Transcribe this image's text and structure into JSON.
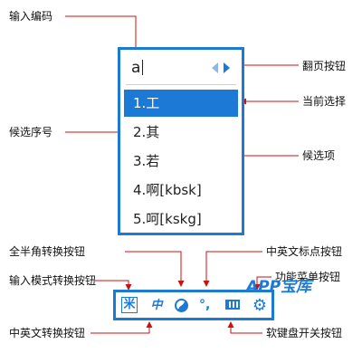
{
  "labels": {
    "input_code": "输入编码",
    "page_button": "翻页按钮",
    "current_choice": "当前选择",
    "candidate_number": "候选序号",
    "candidate_item": "候选项",
    "full_half_toggle": "全半角转换按钮",
    "cn_en_punct": "中英文标点按钮",
    "input_mode_toggle": "输入模式转换按钮",
    "menu_button": "功能菜单按钮",
    "cn_en_toggle": "中英文转换按钮",
    "soft_keyboard_toggle": "软键盘开关按钮"
  },
  "candidate_window": {
    "input": "a",
    "candidates": [
      "1.工",
      "2.其",
      "3.若",
      "4.啊[kbsk]",
      "5.呵[kskg]"
    ],
    "selected_index": 0
  },
  "toolbar": {
    "mode_glyph": "米",
    "zh_glyph": "中",
    "punct_glyph": "°,",
    "gear_glyph": "⚙",
    "icons": [
      "input-mode-icon",
      "chinese-english-icon",
      "half-full-width-icon",
      "punctuation-icon",
      "keyboard-icon",
      "gear-icon"
    ]
  },
  "watermark": "APP宝库",
  "colors": {
    "accent": "#1c7ad6",
    "arrow": "#cc1111"
  }
}
